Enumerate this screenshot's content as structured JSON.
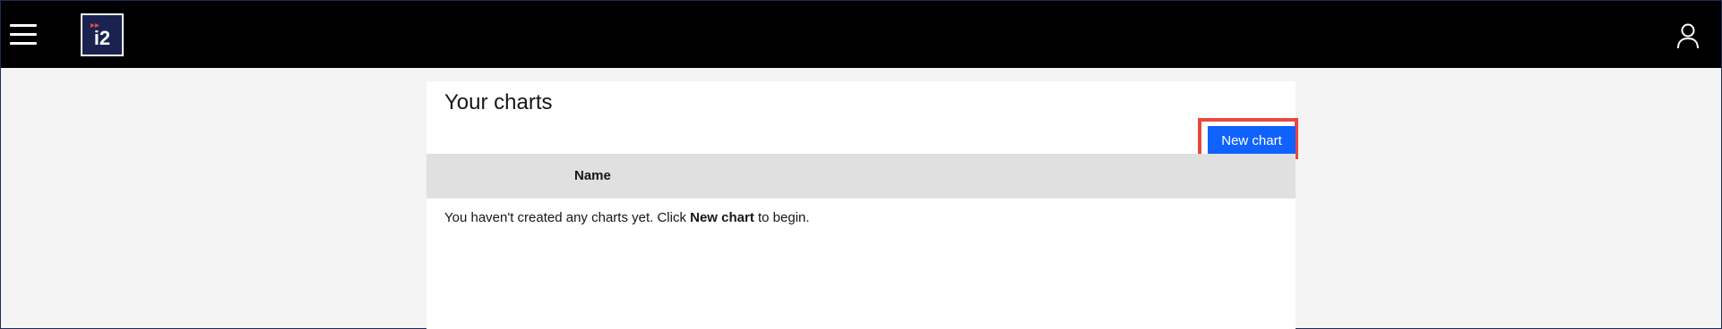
{
  "header": {
    "menu_icon": "hamburger-menu-icon",
    "logo_text": "i2",
    "user_icon": "user-profile-icon"
  },
  "main": {
    "title": "Your charts",
    "new_chart_label": "New chart",
    "table": {
      "columns": [
        "Name"
      ]
    },
    "empty_message": {
      "prefix": "You haven't created any charts yet. Click ",
      "emphasis": "New chart",
      "suffix": " to begin."
    }
  },
  "colors": {
    "topbar": "#000000",
    "primary_button": "#0f62fe",
    "highlight": "#e8483f",
    "table_header": "#e0e0e0",
    "page_bg": "#f4f4f4"
  }
}
